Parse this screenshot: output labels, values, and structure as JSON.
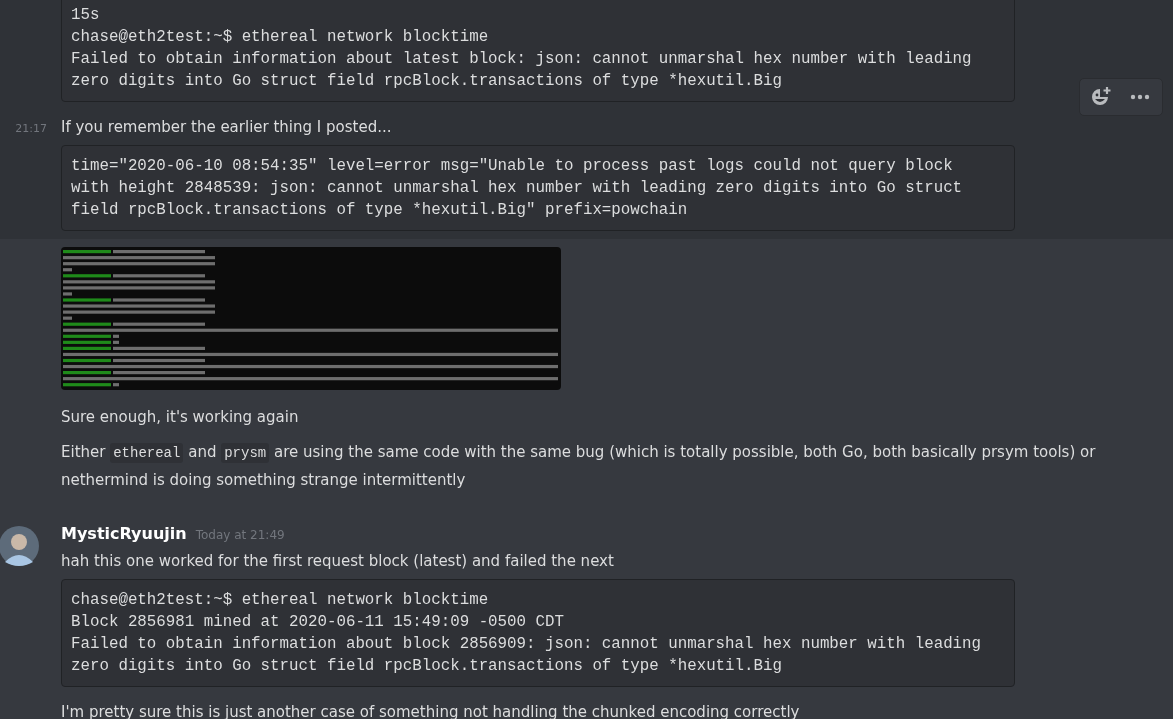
{
  "messages": [
    {
      "kind": "continuation",
      "hovered": true,
      "content": [
        {
          "kind": "code",
          "lines": [
            "15s",
            "chase@eth2test:~$ ethereal network blocktime",
            "Failed to obtain information about latest block: json: cannot unmarshal hex number with leading",
            "zero digits into Go struct field rpcBlock.transactions of type *hexutil.Big"
          ]
        }
      ]
    },
    {
      "kind": "continuation",
      "hovered": true,
      "timestamp": "21:17",
      "content": [
        {
          "kind": "text",
          "parts": [
            {
              "kind": "text",
              "text": "If you remember the earlier thing I posted..."
            }
          ]
        },
        {
          "kind": "code",
          "lines": [
            "time=\"2020-06-10 08:54:35\" level=error msg=\"Unable to process past logs could not query block",
            "with height 2848539: json: cannot unmarshal hex number with leading zero digits into Go struct",
            "field rpcBlock.transactions of type *hexutil.Big\" prefix=powchain"
          ]
        }
      ]
    },
    {
      "kind": "continuation"
    },
    {
      "kind": "continuation",
      "content": [
        {
          "kind": "text",
          "parts": [
            {
              "kind": "text",
              "text": "Sure enough, it's working again"
            }
          ]
        }
      ]
    },
    {
      "kind": "continuation",
      "content": [
        {
          "kind": "text",
          "parts": [
            {
              "kind": "text",
              "text": "Either "
            },
            {
              "kind": "code",
              "text": "ethereal"
            },
            {
              "kind": "text",
              "text": " and "
            },
            {
              "kind": "code",
              "text": "prysm"
            },
            {
              "kind": "text",
              "text": " are using the same code with the same bug (which is totally possible, both Go, both basically prsym tools) or nethermind is doing something strange intermittently"
            }
          ]
        }
      ]
    },
    {
      "kind": "first",
      "author": "MysticRyuujin",
      "timestamp": "Today at 21:49",
      "content": [
        {
          "kind": "text",
          "parts": [
            {
              "kind": "text",
              "text": "hah this one worked for the first request block (latest) and failed the next"
            }
          ]
        },
        {
          "kind": "code",
          "lines": [
            "chase@eth2test:~$ ethereal network blocktime",
            "Block 2856981 mined at 2020-06-11 15:49:09 -0500 CDT",
            "Failed to obtain information about block 2856909: json: cannot unmarshal hex number with leading",
            "zero digits into Go struct field rpcBlock.transactions of type *hexutil.Big"
          ]
        }
      ]
    },
    {
      "kind": "continuation",
      "content": [
        {
          "kind": "text",
          "parts": [
            {
              "kind": "text",
              "text": "I'm pretty sure this is just another case of something not handling the chunked encoding correctly"
            }
          ]
        }
      ]
    }
  ]
}
